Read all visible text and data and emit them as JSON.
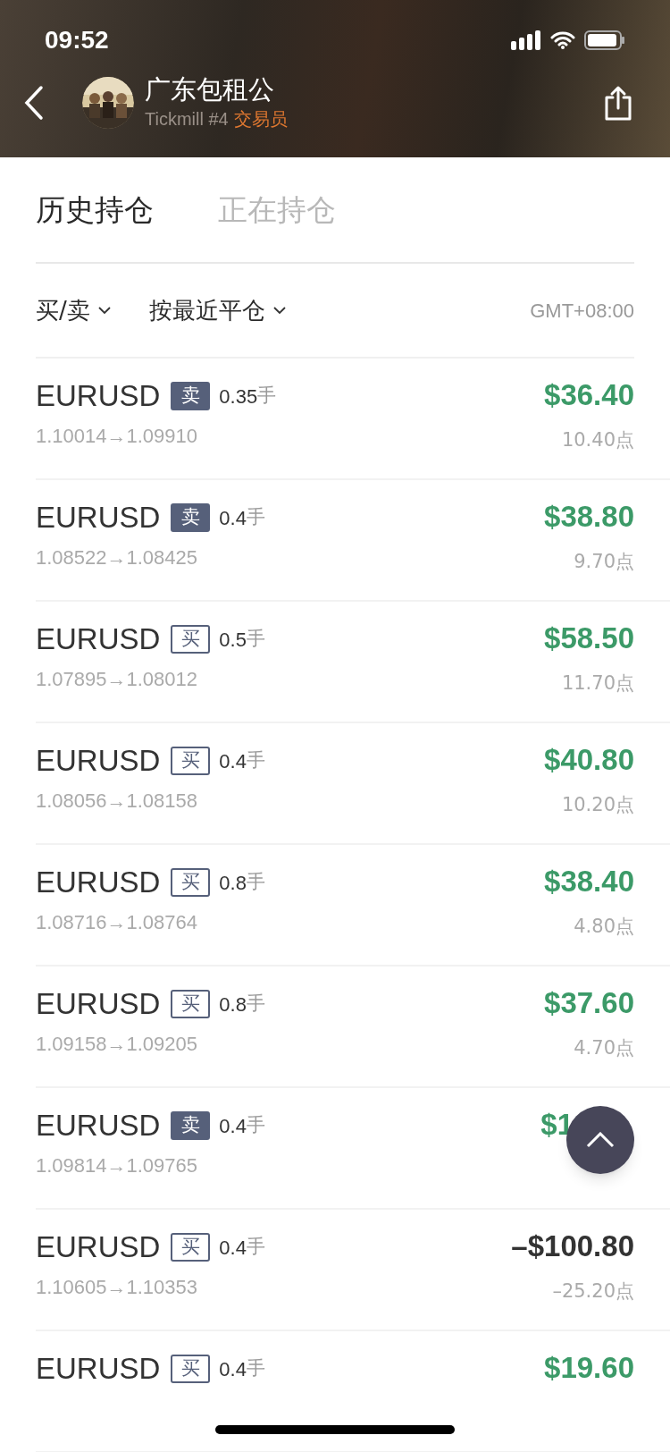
{
  "status_bar": {
    "time": "09:52"
  },
  "header": {
    "name": "广东包租公",
    "broker": "Tickmill #4",
    "role": "交易员"
  },
  "tabs": [
    {
      "label": "历史持仓",
      "selected": true
    },
    {
      "label": "正在持仓",
      "selected": false
    }
  ],
  "filters": [
    {
      "label": "买/卖"
    },
    {
      "label": "按最近平仓"
    }
  ],
  "timezone": "GMT+08:00",
  "trades": [
    {
      "symbol": "EURUSD",
      "kind": "sell",
      "side_label": "卖",
      "lot": "0.35",
      "unit": "手",
      "prices": "1.10014→1.09910",
      "amount": "$36.40",
      "profit": true,
      "points": "10.40点"
    },
    {
      "symbol": "EURUSD",
      "kind": "sell",
      "side_label": "卖",
      "lot": "0.4",
      "unit": "手",
      "prices": "1.08522→1.08425",
      "amount": "$38.80",
      "profit": true,
      "points": "9.70点"
    },
    {
      "symbol": "EURUSD",
      "kind": "buy",
      "side_label": "买",
      "lot": "0.5",
      "unit": "手",
      "prices": "1.07895→1.08012",
      "amount": "$58.50",
      "profit": true,
      "points": "11.70点"
    },
    {
      "symbol": "EURUSD",
      "kind": "buy",
      "side_label": "买",
      "lot": "0.4",
      "unit": "手",
      "prices": "1.08056→1.08158",
      "amount": "$40.80",
      "profit": true,
      "points": "10.20点"
    },
    {
      "symbol": "EURUSD",
      "kind": "buy",
      "side_label": "买",
      "lot": "0.8",
      "unit": "手",
      "prices": "1.08716→1.08764",
      "amount": "$38.40",
      "profit": true,
      "points": "4.80点"
    },
    {
      "symbol": "EURUSD",
      "kind": "buy",
      "side_label": "买",
      "lot": "0.8",
      "unit": "手",
      "prices": "1.09158→1.09205",
      "amount": "$37.60",
      "profit": true,
      "points": "4.70点"
    },
    {
      "symbol": "EURUSD",
      "kind": "sell",
      "side_label": "卖",
      "lot": "0.4",
      "unit": "手",
      "prices": "1.09814→1.09765",
      "amount": "$1",
      "partial": true,
      "profit": true
    },
    {
      "symbol": "EURUSD",
      "kind": "buy",
      "side_label": "买",
      "lot": "0.4",
      "unit": "手",
      "prices": "1.10605→1.10353",
      "amount": "–$100.80",
      "profit": false,
      "points": "–25.20点"
    },
    {
      "symbol": "EURUSD",
      "kind": "buy",
      "side_label": "买",
      "lot": "0.4",
      "unit": "手",
      "amount": "$19.60",
      "profit": true
    }
  ]
}
